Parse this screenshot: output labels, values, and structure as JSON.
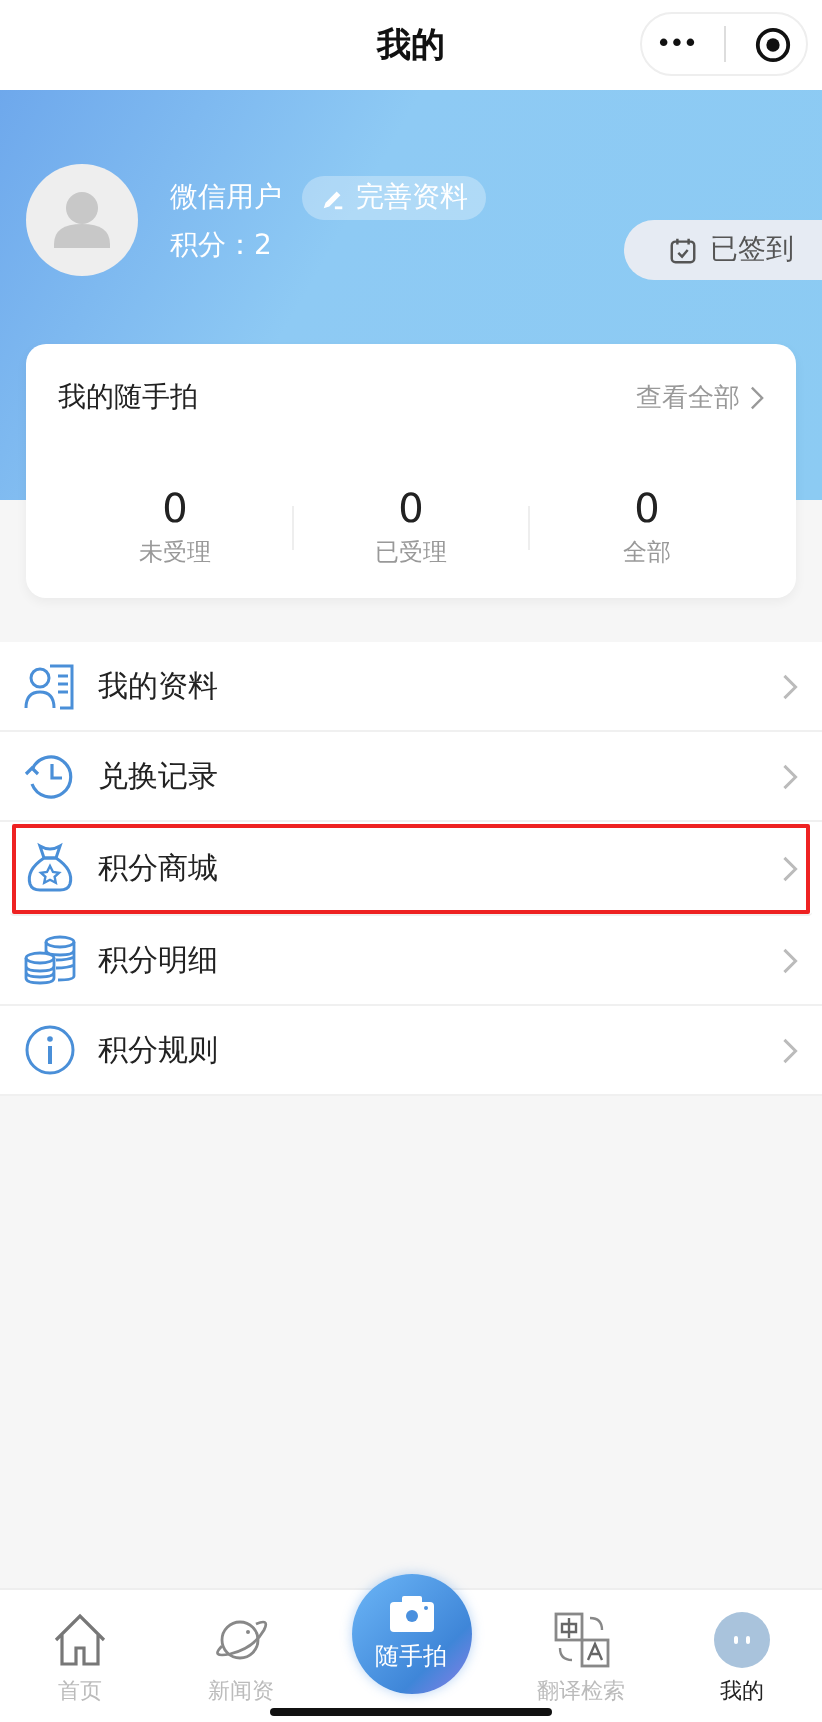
{
  "header": {
    "title": "我的",
    "more_glyph": "•••"
  },
  "profile": {
    "nickname": "微信用户",
    "edit_button": "完善资料",
    "points": "积分：2",
    "signin": {
      "label": "已签到",
      "signed": true
    }
  },
  "card": {
    "title": "我的随手拍",
    "view_all": "查看全部",
    "stats": [
      {
        "value": "0",
        "label": "未受理"
      },
      {
        "value": "0",
        "label": "已受理"
      },
      {
        "value": "0",
        "label": "全部"
      }
    ]
  },
  "menu": [
    {
      "kind": "profile",
      "label": "我的资料",
      "highlighted": false
    },
    {
      "kind": "history",
      "label": "兑换记录",
      "highlighted": false
    },
    {
      "kind": "mall",
      "label": "积分商城",
      "highlighted": true
    },
    {
      "kind": "coins",
      "label": "积分明细",
      "highlighted": false
    },
    {
      "kind": "info",
      "label": "积分规则",
      "highlighted": false
    }
  ],
  "tabbar": [
    {
      "kind": "home",
      "label": "首页",
      "selected": false
    },
    {
      "kind": "news",
      "label": "新闻资",
      "selected": false
    },
    {
      "kind": "camera",
      "label": "随手拍",
      "selected": false
    },
    {
      "kind": "translate",
      "label": "翻译检索",
      "selected": false
    },
    {
      "kind": "me",
      "label": "我的",
      "selected": true
    }
  ]
}
